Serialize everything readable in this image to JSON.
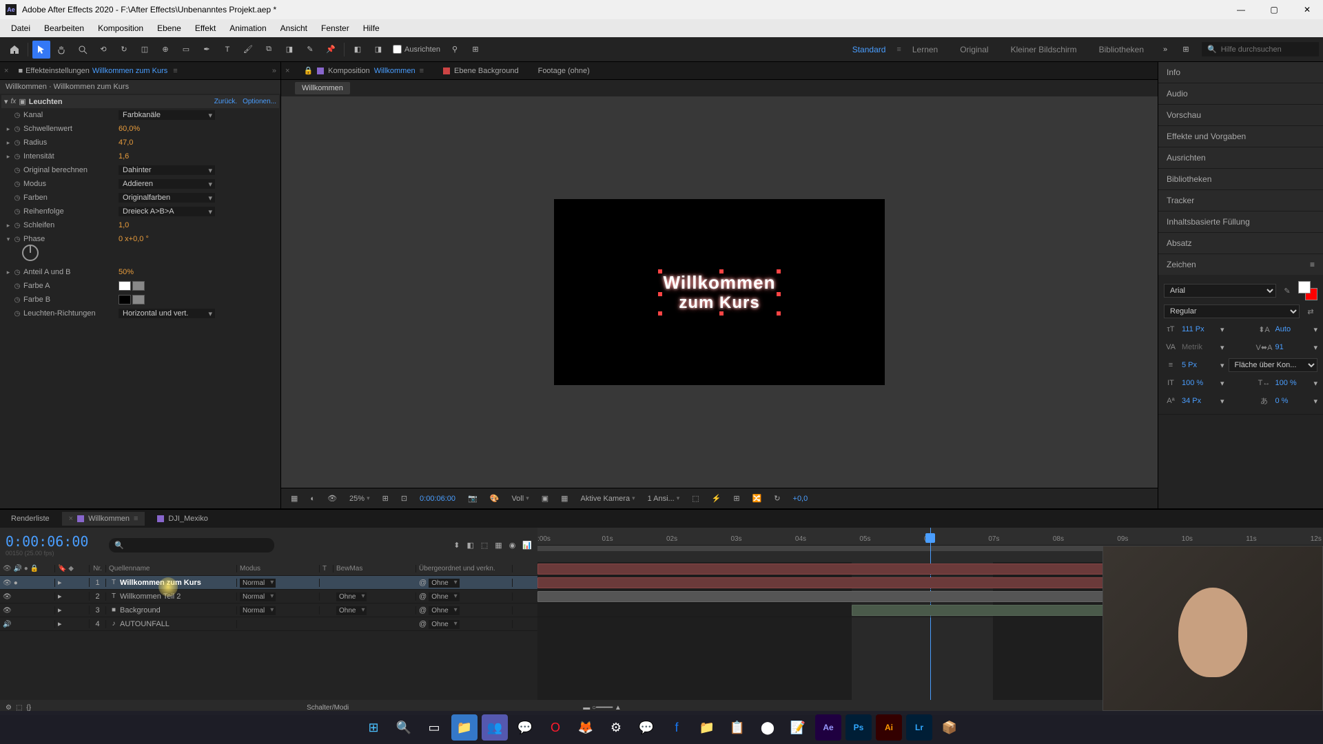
{
  "titlebar": {
    "app": "Adobe After Effects 2020",
    "path": "F:\\After Effects\\Unbenanntes Projekt.aep *"
  },
  "menu": [
    "Datei",
    "Bearbeiten",
    "Komposition",
    "Ebene",
    "Effekt",
    "Animation",
    "Ansicht",
    "Fenster",
    "Hilfe"
  ],
  "toolbar": {
    "ausrichten": "Ausrichten",
    "workspaces": [
      "Standard",
      "Lernen",
      "Original",
      "Kleiner Bildschirm",
      "Bibliotheken"
    ],
    "active_workspace": 0,
    "search_placeholder": "Hilfe durchsuchen"
  },
  "effect_controls": {
    "tab": "Effekteinstellungen",
    "layer": "Willkommen zum Kurs",
    "breadcrumb": "Willkommen · Willkommen zum Kurs",
    "effect_name": "Leuchten",
    "links": {
      "reset": "Zurück.",
      "options": "Optionen..."
    },
    "props": {
      "kanal": {
        "name": "Kanal",
        "value": "Farbkanäle"
      },
      "schwellenwert": {
        "name": "Schwellenwert",
        "value": "60,0%"
      },
      "radius": {
        "name": "Radius",
        "value": "47,0"
      },
      "intensitaet": {
        "name": "Intensität",
        "value": "1,6"
      },
      "original": {
        "name": "Original berechnen",
        "value": "Dahinter"
      },
      "modus": {
        "name": "Modus",
        "value": "Addieren"
      },
      "farben": {
        "name": "Farben",
        "value": "Originalfarben"
      },
      "reihenfolge": {
        "name": "Reihenfolge",
        "value": "Dreieck A>B>A"
      },
      "schleifen": {
        "name": "Schleifen",
        "value": "1,0"
      },
      "phase": {
        "name": "Phase",
        "value": "0 x+0,0 °"
      },
      "anteil": {
        "name": "Anteil A und B",
        "value": "50%"
      },
      "farbe_a": {
        "name": "Farbe A"
      },
      "farbe_b": {
        "name": "Farbe B"
      },
      "richtungen": {
        "name": "Leuchten-Richtungen",
        "value": "Horizontal und vert."
      }
    }
  },
  "comp_panel": {
    "tab_label": "Komposition",
    "comp_name": "Willkommen",
    "layer_tab": "Ebene Background",
    "footage_tab": "Footage (ohne)",
    "breadcrumb": "Willkommen",
    "text": {
      "line1": "Willkommen",
      "line2": "zum Kurs"
    },
    "footer": {
      "zoom": "25%",
      "timecode": "0:00:06:00",
      "resolution": "Voll",
      "camera": "Aktive Kamera",
      "views": "1 Ansi...",
      "exposure": "+0,0"
    }
  },
  "right_panels": [
    "Info",
    "Audio",
    "Vorschau",
    "Effekte und Vorgaben",
    "Ausrichten",
    "Bibliotheken",
    "Tracker",
    "Inhaltsbasierte Füllung",
    "Absatz"
  ],
  "character": {
    "title": "Zeichen",
    "font": "Arial",
    "style": "Regular",
    "size": "111 Px",
    "leading": "Auto",
    "kerning": "Metrik",
    "tracking": "91",
    "stroke": "5 Px",
    "stroke_opt": "Fläche über Kon...",
    "vscale": "100 %",
    "hscale": "100 %",
    "baseline": "34 Px",
    "tsume": "0 %"
  },
  "timeline": {
    "tabs": {
      "render": "Renderliste",
      "comp": "Willkommen",
      "other": "DJI_Mexiko"
    },
    "timecode": "0:00:06:00",
    "fps_label": "00150 (25.00 fps)",
    "columns": {
      "nr": "Nr.",
      "name": "Quellenname",
      "modus": "Modus",
      "t": "T",
      "bewmas": "BewMas",
      "parent": "Übergeordnet und verkn."
    },
    "layers": [
      {
        "num": "1",
        "name": "Willkommen zum Kurs",
        "type": "T",
        "color": "#cc3333",
        "mode": "Normal",
        "trk": "",
        "parent": "Ohne",
        "selected": true,
        "visible": true
      },
      {
        "num": "2",
        "name": "Willkommen Teil 2",
        "type": "T",
        "color": "#cc3333",
        "mode": "Normal",
        "trk": "Ohne",
        "parent": "Ohne",
        "selected": false,
        "visible": true
      },
      {
        "num": "3",
        "name": "Background",
        "type": "",
        "color": "#cc3333",
        "mode": "Normal",
        "trk": "Ohne",
        "parent": "Ohne",
        "selected": false,
        "visible": true
      },
      {
        "num": "4",
        "name": "AUTOUNFALL",
        "type": "A",
        "color": "#66aa88",
        "mode": "",
        "trk": "",
        "parent": "Ohne",
        "selected": false,
        "visible": false
      }
    ],
    "ruler_ticks": [
      ":00s",
      "01s",
      "02s",
      "03s",
      "04s",
      "05s",
      "06s",
      "07s",
      "08s",
      "09s",
      "10s",
      "11s",
      "12s"
    ],
    "footer": "Schalter/Modi"
  }
}
